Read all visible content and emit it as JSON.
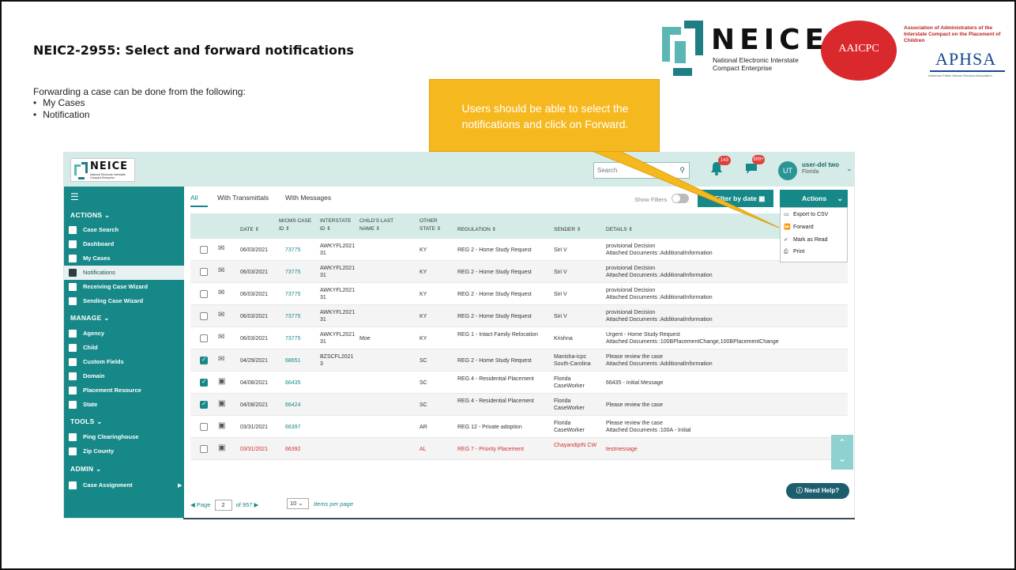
{
  "slide": {
    "title": "NEIC2-2955: Select and forward notifications",
    "intro": "Forwarding a case can be done from the following:",
    "bullets": [
      "My Cases",
      "Notification"
    ],
    "callout": "Users should be able to select the notifications and click on Forward."
  },
  "logos": {
    "neice_word": "NEICE",
    "neice_sub": "National Electronic Interstate Compact Enterprise",
    "aaicpc": "AAICPC",
    "aaicpc_full": "Association of Administrators of the Interstate Compact on the Placement of Children",
    "aphsa": "APHSA",
    "aphsa_small": "American Public Human Services Association"
  },
  "app": {
    "logo_word": "NEICE",
    "logo_sub": "National Electronic Interstate Compact Enterprise",
    "search_placeholder": "Search",
    "bell_count": "143",
    "message_count": "999+",
    "avatar_initials": "UT",
    "user_name": "user-del two",
    "user_state": "Florida",
    "sidebar": {
      "actions_label": "ACTIONS",
      "manage_label": "MANAGE",
      "tools_label": "TOOLS",
      "admin_label": "ADMIN",
      "actions_items": [
        "Case Search",
        "Dashboard",
        "My Cases",
        "Notifications",
        "Receiving Case Wizard",
        "Sending Case Wizard"
      ],
      "manage_items": [
        "Agency",
        "Child",
        "Custom Fields",
        "Domain",
        "Placement Resource",
        "State"
      ],
      "tools_items": [
        "Ping Clearinghouse",
        "Zip County"
      ],
      "admin_items": [
        "Case Assignment"
      ]
    },
    "tabs": [
      "All",
      "With Transmittals",
      "With Messages"
    ],
    "show_filters": "Show Filters",
    "filter_by_date": "Filter by date",
    "actions_button": "Actions",
    "actions_menu": [
      "Export to CSV",
      "Forward",
      "Mark as Read",
      "Print"
    ],
    "columns": [
      "DATE",
      "M/CMS CASE ID",
      "INTERSTATE ID",
      "CHILD'S LAST NAME",
      "OTHER STATE",
      "REGULATION",
      "SENDER",
      "DETAILS"
    ],
    "rows": [
      {
        "date": "06/03/2021",
        "case_id": "73775",
        "interstate_id": "AWKYFL2021 31",
        "last_name": "",
        "state": "KY",
        "regulation": "REG 2 - Home Study Request",
        "sender": "Siri V",
        "details1": "provisional Decision",
        "details2": "Attached Documents :AdditionalInformation"
      },
      {
        "date": "06/03/2021",
        "case_id": "73775",
        "interstate_id": "AWKYFL2021 31",
        "last_name": "",
        "state": "KY",
        "regulation": "REG 2 - Home Study Request",
        "sender": "Siri V",
        "details1": "provisional Decision",
        "details2": "Attached Documents :AdditionalInformation"
      },
      {
        "date": "06/03/2021",
        "case_id": "73775",
        "interstate_id": "AWKYFL2021 31",
        "last_name": "",
        "state": "KY",
        "regulation": "REG 2 - Home Study Request",
        "sender": "Siri V",
        "details1": "provisional Decision",
        "details2": "Attached Documents :AdditionalInformation"
      },
      {
        "date": "06/03/2021",
        "case_id": "73775",
        "interstate_id": "AWKYFL2021 31",
        "last_name": "",
        "state": "KY",
        "regulation": "REG 2 - Home Study Request",
        "sender": "Siri V",
        "details1": "provisional Decision",
        "details2": "Attached Documents :AdditionalInformation"
      },
      {
        "date": "06/03/2021",
        "case_id": "73775",
        "interstate_id": "AWKYFL2021 31",
        "last_name": "Moe",
        "state": "KY",
        "regulation": "REG 1 - Intact Family Relocation",
        "sender": "Krishna",
        "details1": "Urgent - Home Study Request",
        "details2": "Attached Documents :100BPlacementChange,100BPlacementChange"
      },
      {
        "date": "04/29/2021",
        "case_id": "68651",
        "interstate_id": "BZSCFL2021 3",
        "last_name": "",
        "state": "SC",
        "regulation": "REG 2 - Home Study Request",
        "sender": "Manisha-icpc South-Carolina",
        "details1": "Please review the case",
        "details2": "Attached Documents :AdditionalInformation"
      },
      {
        "date": "04/08/2021",
        "case_id": "66435",
        "interstate_id": "",
        "last_name": "",
        "state": "SC",
        "regulation": "REG 4 - Residential Placement",
        "sender": "Florida CaseWorker",
        "details1": "66435 - Initial Message",
        "details2": ""
      },
      {
        "date": "04/08/2021",
        "case_id": "66424",
        "interstate_id": "",
        "last_name": "",
        "state": "SC",
        "regulation": "REG 4 - Residential Placement",
        "sender": "Florida CaseWorker",
        "details1": "Please review the case",
        "details2": ""
      },
      {
        "date": "03/31/2021",
        "case_id": "66397",
        "interstate_id": "",
        "last_name": "",
        "state": "AR",
        "regulation": "REG 12 - Private adoption",
        "sender": "Florida CaseWorker",
        "details1": "Please review the case",
        "details2": "Attached Documents :100A - Initial"
      },
      {
        "date": "03/31/2021",
        "case_id": "66392",
        "interstate_id": "",
        "last_name": "",
        "state": "AL",
        "regulation": "REG 7 - Priority Placement",
        "sender": "ChayandipIN CW",
        "details1": "testmessage",
        "details2": ""
      }
    ],
    "pager": {
      "page_label": "Page",
      "page": "2",
      "of_label": "of 957",
      "per_page": "10",
      "per_page_label": "Items per page"
    },
    "need_help": "Need Help?"
  }
}
